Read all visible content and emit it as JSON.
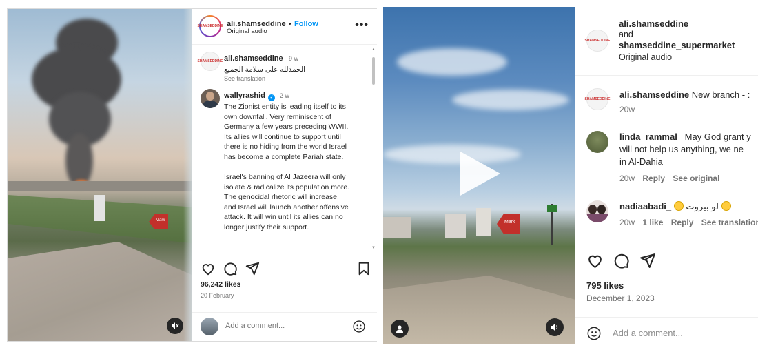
{
  "left_post": {
    "header": {
      "username": "ali.shamseddine",
      "separator": "•",
      "follow_label": "Follow",
      "audio": "Original audio",
      "more_icon": "more-dots-icon",
      "avatar_text": "SHAMSEDDINE"
    },
    "comments": [
      {
        "username": "ali.shamseddine",
        "time": "9 w",
        "text": "الحمدلله على سلامة الجميع",
        "see_translation": "See translation"
      },
      {
        "username": "wallyrashid",
        "verified": true,
        "time": "2 w",
        "paragraph1": "The Zionist entity is leading itself to its own downfall. Very reminiscent of Germany a few years preceding WWII. Its allies will continue to support until there is no hiding from the world Israel has become a complete Pariah state.",
        "paragraph2": "Israel's banning of Al Jazeera will only isolate & radicalize its population more. The genocidal rhetoric will increase, and Israel will launch another offensive attack. It will win until its allies can no longer justify their support."
      }
    ],
    "likes": "96,242 likes",
    "date": "20 February",
    "add_comment_placeholder": "Add a comment...",
    "media": {
      "mute_icon": "speaker-muted-icon",
      "sign_text": "Mark"
    }
  },
  "right_post": {
    "header": {
      "username": "ali.shamseddine",
      "and": "and",
      "collab": "shamseddine_supermarket",
      "audio": "Original audio",
      "avatar_text": "SHAMSEDDINE"
    },
    "comments": [
      {
        "username": "ali.shamseddine",
        "text": "New branch - :",
        "time": "20w"
      },
      {
        "username": "linda_rammal_",
        "line1": "May God grant y",
        "line2": "will not help us anything, we ne",
        "line3": "in Al-Dahia",
        "time": "20w",
        "reply": "Reply",
        "see_original": "See original"
      },
      {
        "username": "nadiaabadi_",
        "text": "لو بيروت",
        "time": "20w",
        "likes": "1 like",
        "reply": "Reply",
        "see_translation": "See translation"
      }
    ],
    "likes": "795 likes",
    "date": "December 1, 2023",
    "add_comment_placeholder": "Add a comment...",
    "media": {
      "play_icon": "play-icon",
      "user_icon": "user-tag-icon",
      "sound_icon": "speaker-icon",
      "sign_text": "Mark"
    }
  }
}
